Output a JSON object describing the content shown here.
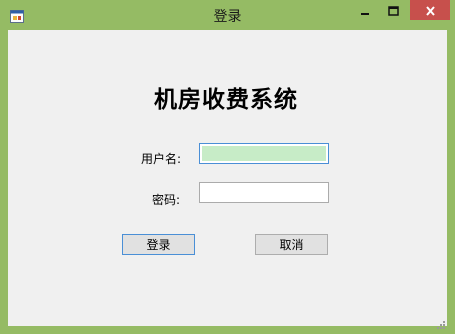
{
  "window": {
    "title": "登录",
    "colors": {
      "frame": "#95bb64",
      "close": "#c7504c",
      "client": "#f0f0f0"
    }
  },
  "titlebar_controls": {
    "icons": [
      "app-icon",
      "minimize-icon",
      "maximize-icon",
      "close-icon"
    ]
  },
  "form": {
    "heading": "机房收费系统",
    "username_label": "用户名:",
    "username_value": "",
    "password_label": "密码:",
    "password_value": "",
    "login_label": "登录",
    "cancel_label": "取消"
  }
}
